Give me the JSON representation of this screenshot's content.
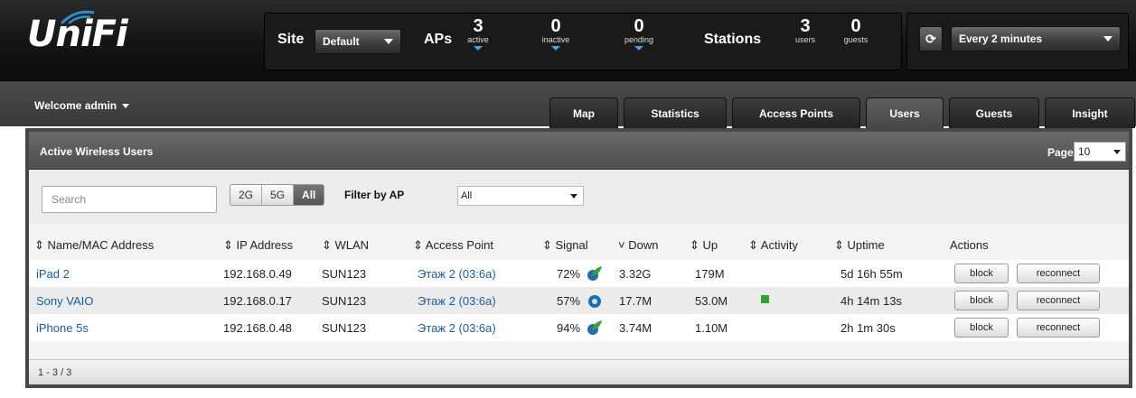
{
  "header": {
    "logo": "UniFi",
    "site_label": "Site",
    "site_value": "Default",
    "aps_label": "APs",
    "stats_aps": [
      {
        "num": "3",
        "sub": "active"
      },
      {
        "num": "0",
        "sub": "inactive"
      },
      {
        "num": "0",
        "sub": "pending"
      }
    ],
    "stations_label": "Stations",
    "stats_stations": [
      {
        "num": "3",
        "sub": "users"
      },
      {
        "num": "0",
        "sub": "guests"
      }
    ],
    "refresh_icon": "refresh-icon",
    "refresh_value": "Every 2 minutes"
  },
  "subheader": {
    "welcome": "Welcome admin",
    "tabs": [
      {
        "label": "Map"
      },
      {
        "label": "Statistics"
      },
      {
        "label": "Access Points"
      },
      {
        "label": "Users"
      },
      {
        "label": "Guests"
      },
      {
        "label": "Insight"
      }
    ],
    "active_tab": "Users"
  },
  "panel": {
    "title": "Active Wireless Users",
    "page_size_label": "Page Size",
    "page_size_value": "10",
    "search_placeholder": "Search",
    "band_filters": [
      "2G",
      "5G",
      "All"
    ],
    "band_selected": "All",
    "filter_label": "Filter by AP",
    "filter_value": "All"
  },
  "table": {
    "columns": [
      "⇕ Name/MAC Address",
      "⇕ IP Address",
      "⇕ WLAN",
      "⇕ Access Point",
      "⇕ Signal",
      "˅ Down",
      "⇕ Up",
      "⇕ Activity",
      "⇕ Uptime",
      "Actions"
    ],
    "rows": [
      {
        "name": "iPad 2",
        "ip": "192.168.0.49",
        "wlan": "SUN123",
        "ap": "Этаж 2 (03:6a)",
        "signal": "72%",
        "signal_icon": "leaf-signal-icon",
        "down": "3.32G",
        "up": "179M",
        "activity": false,
        "uptime": "5d 16h 55m",
        "block": "block",
        "reconnect": "reconnect"
      },
      {
        "name": "Sony VAIO",
        "ip": "192.168.0.17",
        "wlan": "SUN123",
        "ap": "Этаж 2 (03:6a)",
        "signal": "57%",
        "signal_icon": "globe-signal-icon",
        "down": "17.7M",
        "up": "53.0M",
        "activity": true,
        "uptime": "4h 14m 13s",
        "block": "block",
        "reconnect": "reconnect"
      },
      {
        "name": "iPhone 5s",
        "ip": "192.168.0.48",
        "wlan": "SUN123",
        "ap": "Этаж 2 (03:6a)",
        "signal": "94%",
        "signal_icon": "leaf-signal-icon",
        "down": "3.74M",
        "up": "1.10M",
        "activity": false,
        "uptime": "2h 1m 30s",
        "block": "block",
        "reconnect": "reconnect"
      }
    ],
    "footer": "1 - 3 / 3"
  },
  "colors": {
    "link": "#1a5d9a",
    "activity": "#2fa52f",
    "accent_caret": "#4aa3df"
  }
}
